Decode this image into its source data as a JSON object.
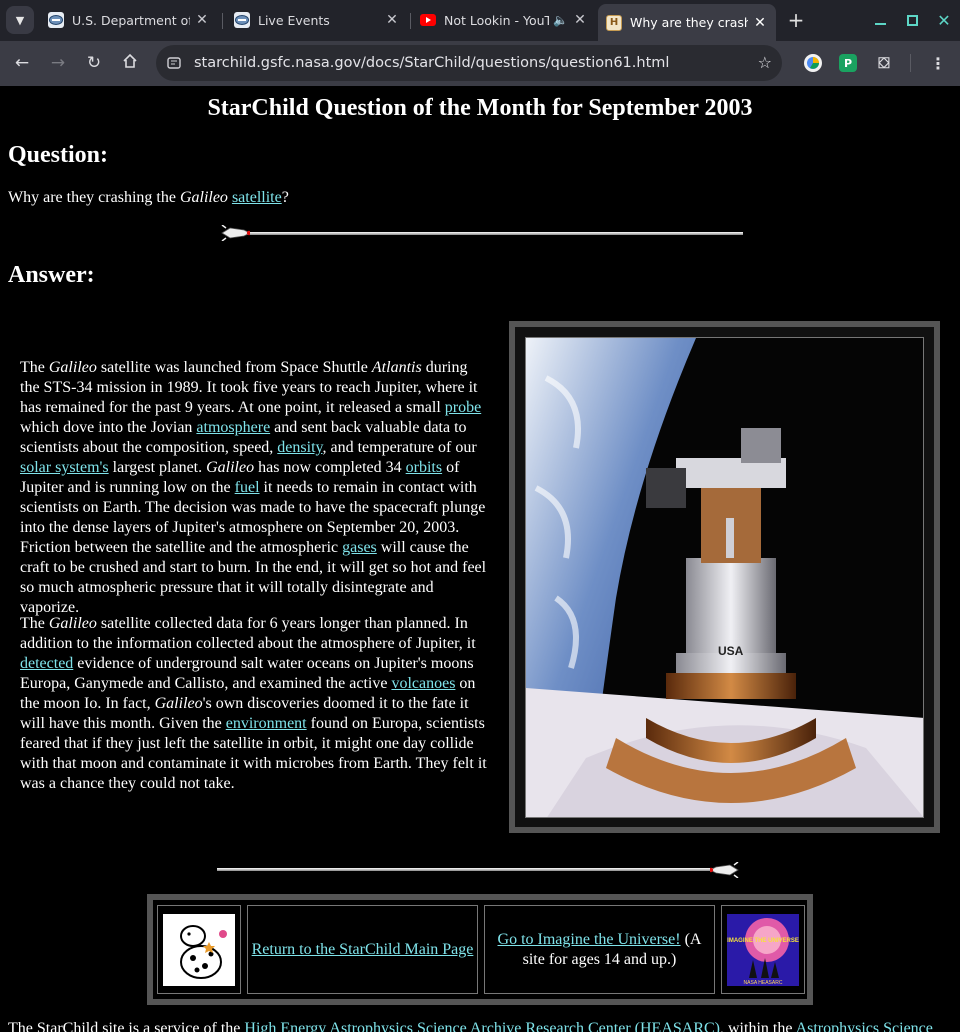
{
  "browser": {
    "tabs": [
      {
        "title": "U.S. Department of De",
        "favicon": "shield-icon"
      },
      {
        "title": "Live Events",
        "favicon": "shield-icon"
      },
      {
        "title": "Not Lookin - YouT",
        "favicon": "youtube-icon",
        "audio": true
      },
      {
        "title": "Why are they crashin",
        "favicon": "starchild-icon",
        "active": true
      }
    ],
    "url": "starchild.gsfc.nasa.gov/docs/StarChild/questions/question61.html"
  },
  "page": {
    "title": "StarChild Question of the Month for September 2003",
    "question_heading": "Question:",
    "question": {
      "pre": "Why are they crashing the ",
      "em": "Galileo",
      "mid": " ",
      "link": "satellite",
      "post": "?"
    },
    "answer_heading": "Answer:",
    "p1": {
      "t1": "The ",
      "e1": "Galileo",
      "t2": " satellite was launched from Space Shuttle ",
      "e2": "Atlantis",
      "t3": " during the STS-34 mission in 1989. It took five years to reach Jupiter, where it has remained for the past 9 years. At one point, it released a small ",
      "l1": "probe",
      "t4": " which dove into the Jovian ",
      "l2": "atmosphere",
      "t5": " and sent back valuable data to scientists about the composition, speed, ",
      "l3": "density",
      "t6": ", and temperature of our ",
      "l4": "solar system's",
      "t7": " largest planet. ",
      "e3": "Galileo",
      "t8": " has now completed 34 ",
      "l5": "orbits",
      "t9": " of Jupiter and is running low on the ",
      "l6": "fuel",
      "t10": " it needs to remain in contact with scientists on Earth. The decision was made to have the spacecraft plunge into the dense layers of Jupiter's atmosphere on September 20, 2003. Friction between the satellite and the atmospheric ",
      "l7": "gases",
      "t11": " will cause the craft to be crushed and start to burn. In the end, it will get so hot and feel so much atmospheric pressure that it will totally disintegrate and vaporize."
    },
    "p2": {
      "t1": "The ",
      "e1": "Galileo",
      "t2": " satellite collected data for 6 years longer than planned. In addition to the information collected about the atmosphere of Jupiter, it ",
      "l1": "detected",
      "t3": " evidence of underground salt water oceans on Jupiter's moons Europa, Ganymede and Callisto, and examined the active ",
      "l2": "volcanoes",
      "t4": " on the moon Io. In fact, ",
      "e2": "Galileo",
      "t5": "'s own discoveries doomed it to the fate it will have this month. Given the ",
      "l3": "environment",
      "t6": " found on Europa, scientists feared that if they just left the satellite in orbit, it might one day collide with that moon and contaminate it with microbes from Earth. They felt it was a chance they could not take."
    },
    "image_text": "USA",
    "footer": {
      "return_link": "Return to the StarChild Main Page",
      "imagine_link": "Go to Imagine the Universe!",
      "imagine_note": " (A site for ages 14 and up.)",
      "imagine_logo_text": "IMAGINE THE UNIVERSE",
      "heasarc_text": "NASA HEASARC"
    },
    "bottom": {
      "t1": "The StarChild site is a service of the ",
      "l1": "High Energy Astrophysics Science Archive Research Center (HEASARC)",
      "t2": ", within the ",
      "l2": "Astrophysics Science"
    }
  }
}
